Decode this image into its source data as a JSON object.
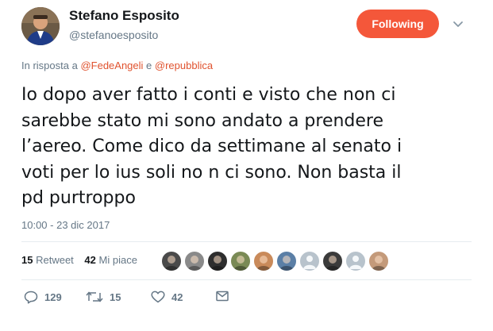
{
  "user": {
    "name": "Stefano Esposito",
    "handle": "@stefanoesposito"
  },
  "follow_button": {
    "label": "Following",
    "color": "#f4573a"
  },
  "reply_to": {
    "prefix": "In risposta a",
    "mention1": "@FedeAngeli",
    "connector": "e",
    "mention2": "@repubblica"
  },
  "tweet": {
    "lines": [
      "Io dopo aver fatto i conti e visto che non ci",
      "sarebbe stato mi sono andato a prendere",
      "l’aereo. Come dico da settimane al senato i",
      "voti per lo ius soli no n ci sono. Non basta il",
      "pd purtroppo"
    ],
    "timestamp": "10:00 - 23 dic 2017"
  },
  "stats": {
    "retweets_count": "15",
    "retweets_label": "Retweet",
    "likes_count": "42",
    "likes_label": "Mi piace"
  },
  "liker_avatars": [
    {
      "icon": "user-avatar",
      "color": "#4a4a4a"
    },
    {
      "icon": "user-avatar",
      "color": "#8a8a8a"
    },
    {
      "icon": "user-avatar",
      "color": "#2e2e2e"
    },
    {
      "icon": "user-avatar",
      "color": "#7a8a55"
    },
    {
      "icon": "user-avatar",
      "color": "#c98a5a"
    },
    {
      "icon": "user-avatar",
      "color": "#5b7fa6"
    },
    {
      "icon": "default-egg-avatar",
      "color": "#b8c3cc"
    },
    {
      "icon": "user-avatar",
      "color": "#3b3b3b"
    },
    {
      "icon": "default-egg-avatar",
      "color": "#b8c3cc"
    },
    {
      "icon": "user-avatar",
      "color": "#c49a7a"
    }
  ],
  "actions": {
    "replies": "129",
    "retweets": "15",
    "likes": "42"
  },
  "colors": {
    "accent": "#f4573a",
    "mention": "#e0522e",
    "muted": "#657786",
    "text": "#14171a"
  }
}
